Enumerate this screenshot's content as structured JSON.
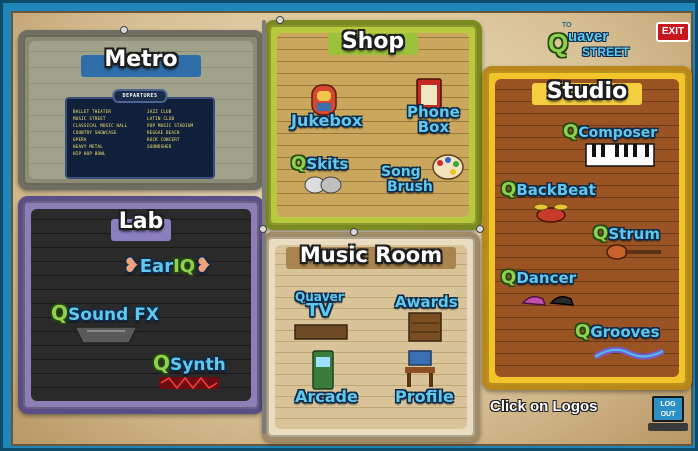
{
  "top_bar": {
    "exit_label": "EXIT",
    "logo_to": "TO",
    "logo_q": "Q",
    "logo_quaver": "uaver",
    "logo_street": "STREET"
  },
  "rooms": {
    "metro": {
      "title": "Metro",
      "departures_label": "DEPARTURES",
      "departures_left": [
        "BALLET THEATER",
        "MUSIC STREET",
        "CLASSICAL MUSIC HALL",
        "COUNTRY SHOWCASE",
        "OPERA",
        "HEAVY METAL",
        "HIP HOP BOWL"
      ],
      "departures_right": [
        "JAZZ CLUB",
        "LATIN CLUB",
        "POP MUSIC STADIUM",
        "REGGAE BEACH",
        "ROCK CONCERT",
        "SOUNDSHED"
      ]
    },
    "shop": {
      "title": "Shop",
      "jukebox": "Jukebox",
      "phone_box_1": "Phone",
      "phone_box_2": "Box",
      "skits_q": "Q",
      "skits": "Skits",
      "song_brush_1": "Song",
      "song_brush_2": "Brush"
    },
    "lab": {
      "title": "Lab",
      "ear_iq_1": "Ear",
      "ear_iq_2": "IQ",
      "sound_fx_q": "Q",
      "sound_fx": "Sound FX",
      "synth_q": "Q",
      "synth": "Synth"
    },
    "music_room": {
      "title": "Music Room",
      "quaver_tv_1": "Quaver",
      "quaver_tv_2": "TV",
      "awards": "Awards",
      "arcade": "Arcade",
      "profile": "Profile"
    },
    "studio": {
      "title": "Studio",
      "composer_q": "Q",
      "composer": "Composer",
      "backbeat_q": "Q",
      "backbeat": "BackBeat",
      "strum_q": "Q",
      "strum": "Strum",
      "dancer_q": "Q",
      "dancer": "Dancer",
      "grooves_q": "Q",
      "grooves": "Grooves"
    }
  },
  "footer": {
    "hint": "Click on Logos",
    "logout_line1": "LOG",
    "logout_line2": "OUT"
  },
  "colors": {
    "frame": "#1e86b8",
    "logo_blue": "#5fc8ec",
    "q_green": "#8fd14f",
    "exit_red": "#c8171c"
  }
}
